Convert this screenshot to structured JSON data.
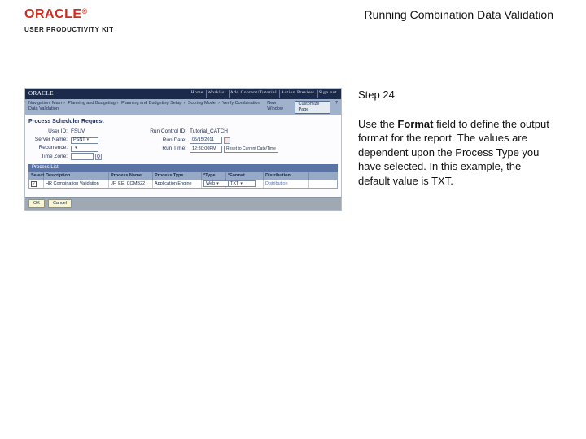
{
  "header": {
    "logo_text": "ORACLE",
    "logo_reg": "®",
    "upk_label": "USER PRODUCTIVITY KIT",
    "doc_title": "Running Combination Data Validation"
  },
  "instruction": {
    "step_label": "Step 24",
    "body_pre": "Use the ",
    "body_bold": "Format",
    "body_post": " field to define the output format for the report. The values are dependent upon the Process Type you have selected. In this example, the default value is TXT."
  },
  "app": {
    "brand": "ORACLE",
    "topnav": [
      "Home",
      "Worklist",
      "Add Content/Tutorial",
      "Action Preview",
      "Sign out"
    ],
    "breadcrumb": [
      "Navigation: Main",
      "Planning and Budgeting",
      "Planning and Budgeting Setup",
      "Scoring Model",
      "Verify Combination Data Validation"
    ],
    "new_window_label": "New Window",
    "customize_label": "Customize Page",
    "page_title": "Process Scheduler Request",
    "form": {
      "left": [
        {
          "label": "User ID:",
          "value": "FSUV"
        },
        {
          "label": "Server Name:",
          "value": "PSNT",
          "select": true
        },
        {
          "label": "Recurrence:",
          "value": ""
        },
        {
          "label": "Time Zone:",
          "value": ""
        }
      ],
      "right": [
        {
          "label": "Run Control ID:",
          "value": "Tutorial_CATCH"
        },
        {
          "label": "Run Date:",
          "value": "05/15/2011"
        },
        {
          "label": "Run Time:",
          "value": "12:30:00PM"
        },
        {
          "label_inline": "Reset to Current Date/Time"
        }
      ]
    },
    "process_list_label": "Process List",
    "table": {
      "headers": [
        "Select",
        "Description",
        "Process Name",
        "Process Type",
        "*Type",
        "*Format",
        "Distribution"
      ],
      "row": {
        "select_checked": true,
        "description": "HR Combination Validation",
        "process_name": "JF_EE_COMB22",
        "process_type": "Application Engine",
        "type_value": "Web",
        "format_value": "TXT",
        "distribution": "Distribution"
      }
    },
    "buttons": {
      "ok": "OK",
      "cancel": "Cancel"
    }
  }
}
